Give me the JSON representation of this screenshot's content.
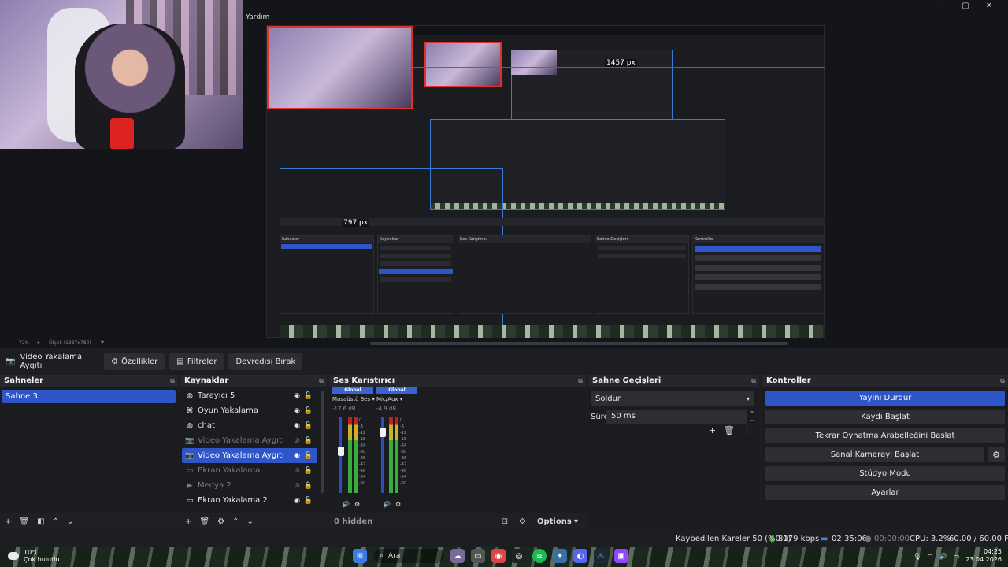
{
  "preview": {
    "help_label": "Yardım",
    "window_controls": [
      "–",
      "▢",
      "✕"
    ],
    "measure_h": "1457 px",
    "measure_v": "797 px",
    "zoom_minus": "–",
    "zoom_level": "72%",
    "zoom_plus": "+",
    "zoom_label": "Ölçek (1387x780)"
  },
  "toolbar": {
    "source_name": "Video Yakalama Aygıtı",
    "properties": "Özellikler",
    "filters": "Filtreler",
    "deactivate": "Devredışı Bırak"
  },
  "scenes": {
    "title": "Sahneler",
    "items": [
      "Sahne 3"
    ]
  },
  "sources": {
    "title": "Kaynaklar",
    "items": [
      {
        "label": "Tarayıcı 5",
        "icon": "globe-icon",
        "visible": true,
        "locked": false,
        "dim": false,
        "selected": false
      },
      {
        "label": "Oyun Yakalama",
        "icon": "gamepad-icon",
        "visible": true,
        "locked": false,
        "dim": false,
        "selected": false
      },
      {
        "label": "chat",
        "icon": "globe-icon",
        "visible": true,
        "locked": false,
        "dim": false,
        "selected": false
      },
      {
        "label": "Video Yakalama Aygıtı",
        "icon": "camera-icon",
        "visible": false,
        "locked": false,
        "dim": true,
        "selected": false
      },
      {
        "label": "Video Yakalama Aygıtı",
        "icon": "camera-icon",
        "visible": true,
        "locked": false,
        "dim": false,
        "selected": true
      },
      {
        "label": "Ekran Yakalama",
        "icon": "monitor-icon",
        "visible": false,
        "locked": false,
        "dim": true,
        "selected": false
      },
      {
        "label": "Medya 2",
        "icon": "play-icon",
        "visible": false,
        "locked": true,
        "dim": true,
        "selected": false
      },
      {
        "label": "Ekran Yakalama 2",
        "icon": "monitor-icon",
        "visible": true,
        "locked": false,
        "dim": false,
        "selected": false
      }
    ]
  },
  "mixer": {
    "title": "Ses Karıştırıcı",
    "channels": [
      {
        "badge": "Global",
        "name": "Masaüstü Ses",
        "db": "-17.6 dB",
        "level": 0.55
      },
      {
        "badge": "Global",
        "name": "Mic/Aux",
        "db": "-4.9 dB",
        "level": 0.8
      }
    ],
    "scale": [
      "0",
      "-6",
      "-12",
      "-18",
      "-24",
      "-30",
      "-36",
      "-42",
      "-48",
      "-54",
      "-60"
    ],
    "hidden_count": "0 hidden",
    "options": "Options"
  },
  "transitions": {
    "title": "Sahne Geçişleri",
    "selected": "Soldur",
    "duration_label": "Süre",
    "duration_value": "50 ms"
  },
  "controls": {
    "title": "Kontroller",
    "stop_stream": "Yayını Durdur",
    "start_recording": "Kaydı Başlat",
    "start_replay": "Tekrar Oynatma Arabelleğini Başlat",
    "start_virtual_cam": "Sanal Kamerayı Başlat",
    "studio_mode": "Stüdyo Modu",
    "settings": "Ayarlar"
  },
  "status": {
    "dropped": "Kaybedilen Kareler 50 (%0.0)",
    "bitrate": "8179 kbps",
    "stream_time": "02:35:06",
    "rec_time": "00:00:00",
    "cpu": "CPU: 3.2%",
    "fps": "60.00 / 60.00 FPS"
  },
  "taskbar": {
    "temp": "10°C",
    "weather": "Çok bulutlu",
    "search": "Ara",
    "time": "04:25",
    "date": "23.04.2026"
  }
}
